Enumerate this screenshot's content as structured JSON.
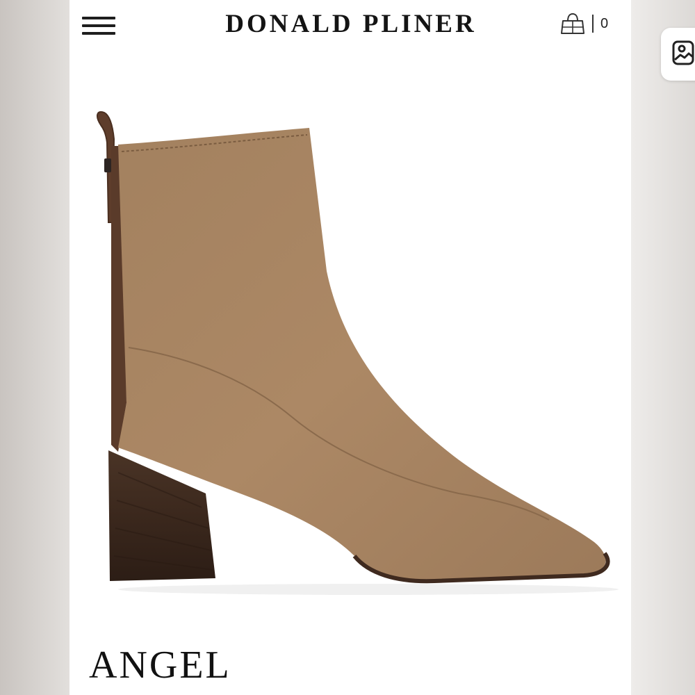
{
  "header": {
    "brand": "DONALD PLINER",
    "cart_count": "0",
    "menu_icon": "hamburger-menu-icon",
    "cart_icon": "shopping-bag-icon"
  },
  "product": {
    "name": "ANGEL",
    "image_icon": "ankle-boot-image"
  },
  "overlay": {
    "icon": "photo-gallery-icon"
  },
  "colors": {
    "boot_suede": "#a78463",
    "heel": "#3f2a1f",
    "pull_tab": "#5e3d2b",
    "text": "#141414",
    "background": "#ffffff"
  }
}
